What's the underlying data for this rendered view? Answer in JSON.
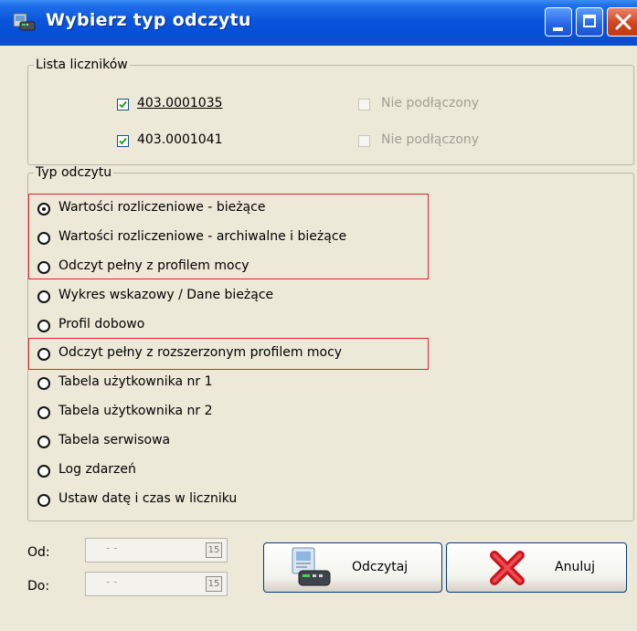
{
  "window": {
    "title": "Wybierz typ odczytu",
    "accent_color": "#0a55dc",
    "highlight_color": "#e0232a"
  },
  "meters": {
    "legend": "Lista liczników",
    "items": [
      {
        "label": "403.0001035",
        "checked": true
      },
      {
        "label": "403.0001041",
        "checked": true
      }
    ],
    "disabled": [
      {
        "label": "Nie podłączony",
        "checked": false
      },
      {
        "label": "Nie podłączony",
        "checked": false
      }
    ]
  },
  "reading_type": {
    "legend": "Typ odczytu",
    "selected": "Wartości rozliczeniowe - bieżące",
    "options": [
      "Wartości rozliczeniowe - bieżące",
      "Wartości rozliczeniowe - archiwalne i bieżące",
      "Odczyt pełny z profilem mocy",
      "Wykres wskazowy / Dane bieżące",
      "Profil dobowo",
      "Odczyt pełny z rozszerzonym profilem mocy",
      "Tabela użytkownika nr 1",
      "Tabela użytkownika nr 2",
      "Tabela serwisowa",
      "Log zdarzeń",
      "Ustaw datę i czas w liczniku"
    ]
  },
  "dates": {
    "from_label": "Od:",
    "to_label": "Do:",
    "from_value": "- -",
    "to_value": "- -",
    "calendar_glyph": "15"
  },
  "actions": {
    "read_label": "Odczytaj",
    "cancel_label": "Anuluj"
  }
}
